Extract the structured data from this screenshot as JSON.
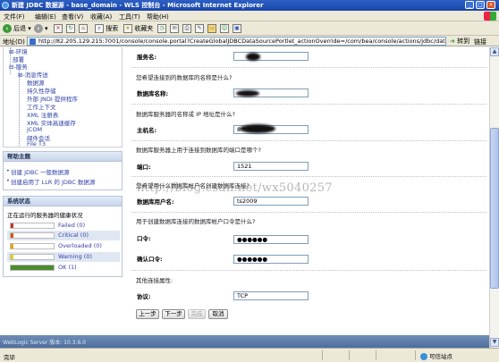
{
  "window": {
    "title": "新建 JDBC 数据源 - base_domain - WLS 控制台 - Microsoft Internet Explorer",
    "min": "_",
    "max": "□",
    "close": "×"
  },
  "menubar": {
    "items": [
      "文件(F)",
      "编辑(E)",
      "查看(V)",
      "收藏(A)",
      "工具(T)",
      "帮助(H)"
    ]
  },
  "toolbar": {
    "back": "后退",
    "search": "搜索",
    "favorites": "收藏夹"
  },
  "addressbar": {
    "label": "地址(D)",
    "url": "http://82.205.129.215:7001/console/console.portal?CreateGlobalJDBCDataSourcePortlet_actionOverride=/com/bea/console/actions/jdbc/datasou",
    "go": "转到",
    "links": "链接"
  },
  "tree": {
    "items": [
      "环境",
      "部署",
      "服务",
      "消息传送",
      "数据源",
      "持久性存储",
      "外部 JNDI 提供程序",
      "工作上下文",
      "XML 注册表",
      "XML 实体高速缓存",
      "jCOM",
      "邮件会话",
      "File T3"
    ]
  },
  "help_panel": {
    "title": "帮助主题",
    "links": [
      "创建 JDBC 一般数据源",
      "创建启用了 LLR 的 JDBC 数据源"
    ]
  },
  "system_status": {
    "title": "系统状态",
    "subtitle": "正在运行的服务器的健康状况",
    "rows": [
      {
        "label": "Failed (0)",
        "value": 0,
        "color": "#c0392b"
      },
      {
        "label": "Critical (0)",
        "value": 0,
        "color": "#d35400"
      },
      {
        "label": "Overloaded (0)",
        "value": 0,
        "color": "#e6a100"
      },
      {
        "label": "Warning (0)",
        "value": 0,
        "color": "#e6d200"
      },
      {
        "label": "OK (1)",
        "value": 1,
        "color": "#4c8a2e"
      }
    ]
  },
  "form": {
    "fields": {
      "service_name": {
        "label": "服务名:",
        "value": ""
      },
      "db_name_question": "您希望连接到的数据库的名称是什么?",
      "db_name": {
        "label": "数据库名称:",
        "value": ""
      },
      "host_question": "数据库服务器的名称或 IP 地址是什么?",
      "host": {
        "label": "主机名:",
        "value": "8"
      },
      "port_question": "数据库服务器上用于连接到数据库的端口是哪个?",
      "port": {
        "label": "端口:",
        "value": "1521"
      },
      "user_question": "您希望用什么数据库帐户名创建数据库连接?",
      "user": {
        "label": "数据库用户名:",
        "value": "ts2009"
      },
      "password_question": "用于创建数据库连接的数据库帐户口令是什么?",
      "password": {
        "label": "口令:",
        "value": "●●●●●●"
      },
      "confirm": {
        "label": "确认口令:",
        "value": "●●●●●●"
      },
      "other_attrs": "其他连接属性:",
      "protocol": {
        "label": "协议:",
        "value": "TCP"
      }
    },
    "buttons": {
      "back": "上一步",
      "next": "下一步",
      "finish": "完成",
      "cancel": "取消"
    }
  },
  "footer": {
    "text": "WebLogic Server 版本: 10.3.6.0"
  },
  "watermark": "http://blog.csdn.net/wx5040257",
  "statusbar": {
    "text": "完毕",
    "zone": "可信站点"
  }
}
